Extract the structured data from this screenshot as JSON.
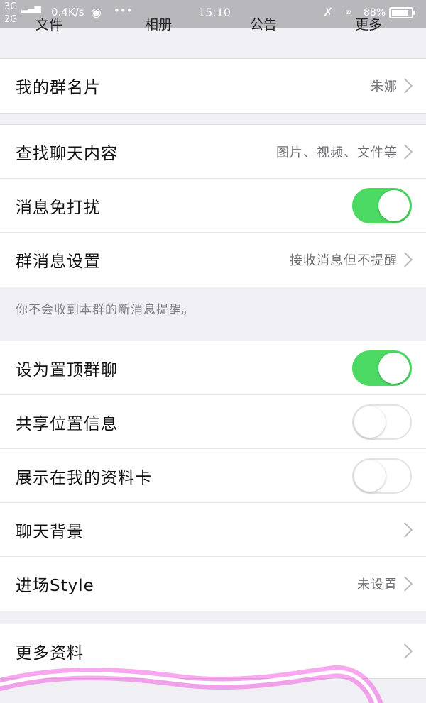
{
  "status_bar": {
    "network_top": "3G",
    "network_bottom": "2G",
    "speed": "0.4K/s",
    "more": "•••",
    "time": "15:10",
    "battery": "88%",
    "battery_level": 0.88
  },
  "tabs": [
    "文件",
    "相册",
    "公告",
    "更多"
  ],
  "group1": {
    "card": {
      "label": "我的群名片",
      "value": "朱娜"
    }
  },
  "group2": {
    "search": {
      "label": "查找聊天内容",
      "value": "图片、视频、文件等"
    },
    "dnd": {
      "label": "消息免打扰",
      "on": true
    },
    "msg_settings": {
      "label": "群消息设置",
      "value": "接收消息但不提醒"
    }
  },
  "note": "你不会收到本群的新消息提醒。",
  "group3": {
    "pin": {
      "label": "设为置顶群聊",
      "on": true
    },
    "location": {
      "label": "共享位置信息",
      "on": false
    },
    "profile_card": {
      "label": "展示在我的资料卡",
      "on": false
    },
    "background": {
      "label": "聊天背景"
    },
    "entry_style": {
      "label": "进场Style",
      "value": "未设置"
    }
  },
  "group4": {
    "more_info": {
      "label": "更多资料"
    }
  },
  "colors": {
    "toggle_on": "#4cd964",
    "background": "#efeff4"
  }
}
